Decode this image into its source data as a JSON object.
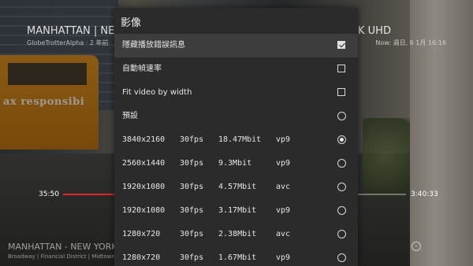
{
  "overlay": {
    "title_left": "MANHATTAN | NEW",
    "title_right": "K UHD",
    "channel": "GlobeTrotterAlpha · 2 年前",
    "now": "Now: 週日, 6 1月 16:16",
    "current_time": "35:50",
    "duration": "3:40:33",
    "progress_fraction": 0.16,
    "bottom_title": "MANHATTAN - NEW YORK C",
    "bottom_sub": "Broadway | Financial District | Midtown",
    "bus_text": "ax responsibi"
  },
  "dialog": {
    "title": "影像",
    "toggles": [
      {
        "label": "隱藏播放錯誤訊息",
        "checked": true
      },
      {
        "label": "自動幀速率",
        "checked": false
      },
      {
        "label": "Fit video by width",
        "checked": false
      }
    ],
    "default_option": {
      "label": "預設",
      "selected": false
    },
    "formats": [
      {
        "resolution": "3840x2160",
        "fps": "30fps",
        "bitrate": "18.47Mbit",
        "codec": "vp9",
        "selected": true
      },
      {
        "resolution": "2560x1440",
        "fps": "30fps",
        "bitrate": "9.3Mbit",
        "codec": "vp9",
        "selected": false
      },
      {
        "resolution": "1920x1080",
        "fps": "30fps",
        "bitrate": "4.57Mbit",
        "codec": "avc",
        "selected": false
      },
      {
        "resolution": "1920x1080",
        "fps": "30fps",
        "bitrate": "3.17Mbit",
        "codec": "vp9",
        "selected": false
      },
      {
        "resolution": "1280x720",
        "fps": "30fps",
        "bitrate": "2.38Mbit",
        "codec": "avc",
        "selected": false
      },
      {
        "resolution": "1280x720",
        "fps": "30fps",
        "bitrate": "1.67Mbit",
        "codec": "vp9",
        "selected": false
      }
    ]
  },
  "colors": {
    "dialog_bg": "#2b2b2b",
    "selected_row_bg": "#3d3d3d",
    "progress_red": "#e3242b"
  }
}
